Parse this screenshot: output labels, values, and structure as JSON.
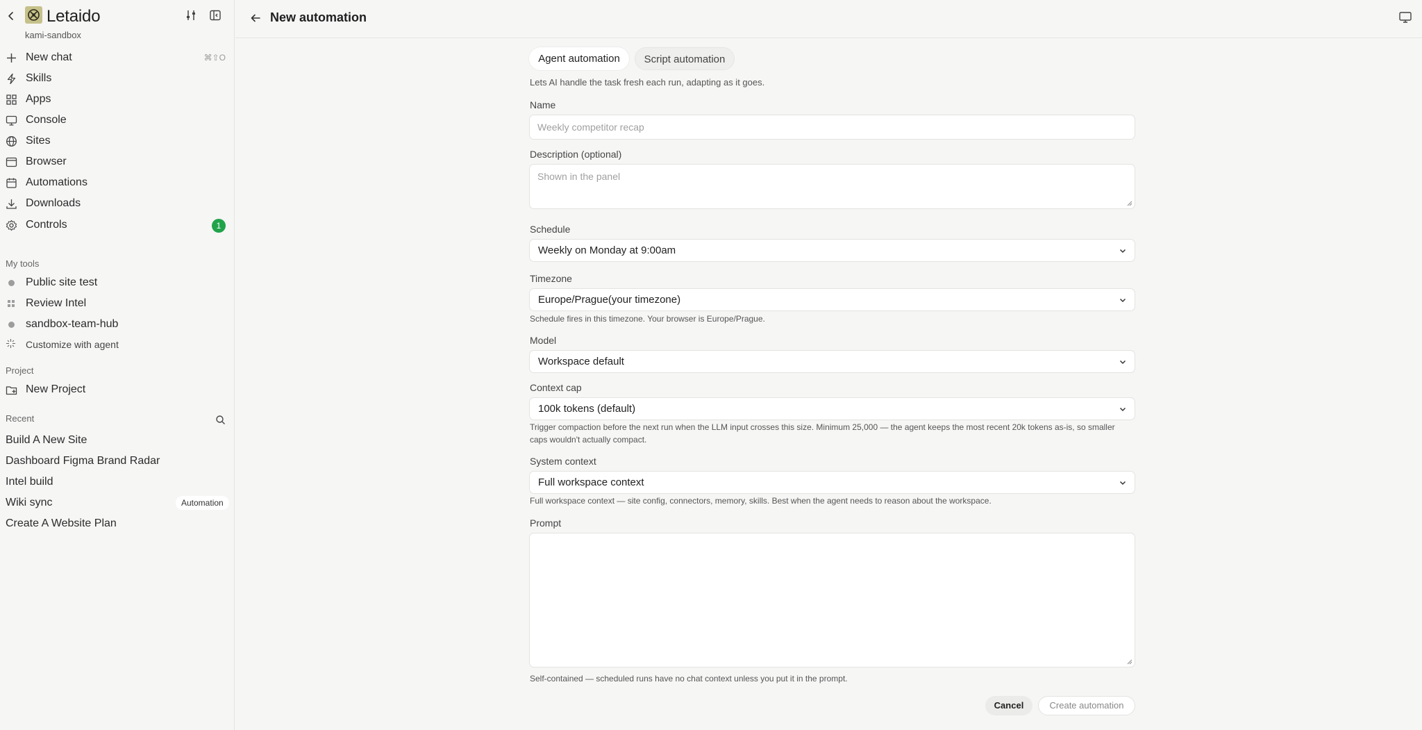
{
  "sidebar": {
    "brand": "Letaido",
    "workspace": "kami-sandbox",
    "nav": [
      {
        "label": "New chat",
        "icon": "plus-icon",
        "shortcut": "⌘⇧O"
      },
      {
        "label": "Skills",
        "icon": "bolt-icon"
      },
      {
        "label": "Apps",
        "icon": "grid-icon"
      },
      {
        "label": "Console",
        "icon": "monitor-icon"
      },
      {
        "label": "Sites",
        "icon": "globe-icon"
      },
      {
        "label": "Browser",
        "icon": "browser-window-icon"
      },
      {
        "label": "Automations",
        "icon": "calendar-icon"
      },
      {
        "label": "Downloads",
        "icon": "download-icon"
      },
      {
        "label": "Controls",
        "icon": "gear-icon",
        "badge": "1"
      }
    ],
    "my_tools_label": "My tools",
    "tools": [
      {
        "label": "Public site test"
      },
      {
        "label": "Review Intel"
      },
      {
        "label": "sandbox-team-hub"
      },
      {
        "label": "Customize with agent"
      }
    ],
    "project_label": "Project",
    "new_project": "New Project",
    "recent_label": "Recent",
    "recent": [
      {
        "label": "Build A New Site"
      },
      {
        "label": "Dashboard Figma Brand Radar"
      },
      {
        "label": "Intel build"
      },
      {
        "label": "Wiki sync",
        "tag": "Automation"
      },
      {
        "label": "Create A Website Plan"
      }
    ]
  },
  "header": {
    "title": "New automation"
  },
  "form": {
    "tabs": [
      {
        "label": "Agent automation",
        "active": true
      },
      {
        "label": "Script automation",
        "active": false
      }
    ],
    "mode_description": "Lets AI handle the task fresh each run, adapting as it goes.",
    "name_label": "Name",
    "name_placeholder": "Weekly competitor recap",
    "description_label": "Description (optional)",
    "description_placeholder": "Shown in the panel",
    "schedule_label": "Schedule",
    "schedule_value": "Weekly on Monday at 9:00am",
    "timezone_label": "Timezone",
    "timezone_value": "Europe/Prague(your timezone)",
    "timezone_help": "Schedule fires in this timezone. Your browser is Europe/Prague.",
    "model_label": "Model",
    "model_value": "Workspace default",
    "context_cap_label": "Context cap",
    "context_cap_value": "100k tokens (default)",
    "context_cap_help": "Trigger compaction before the next run when the LLM input crosses this size. Minimum 25,000 — the agent keeps the most recent 20k tokens as-is, so smaller caps wouldn't actually compact.",
    "system_context_label": "System context",
    "system_context_value": "Full workspace context",
    "system_context_help": "Full workspace context — site config, connectors, memory, skills. Best when the agent needs to reason about the workspace.",
    "prompt_label": "Prompt",
    "prompt_value": "",
    "prompt_help": "Self-contained — scheduled runs have no chat context unless you put it in the prompt.",
    "cancel_label": "Cancel",
    "create_label": "Create automation"
  },
  "colors": {
    "background": "#f6f6f5",
    "badge": "#21a34a",
    "logo": "#c6c18a"
  }
}
